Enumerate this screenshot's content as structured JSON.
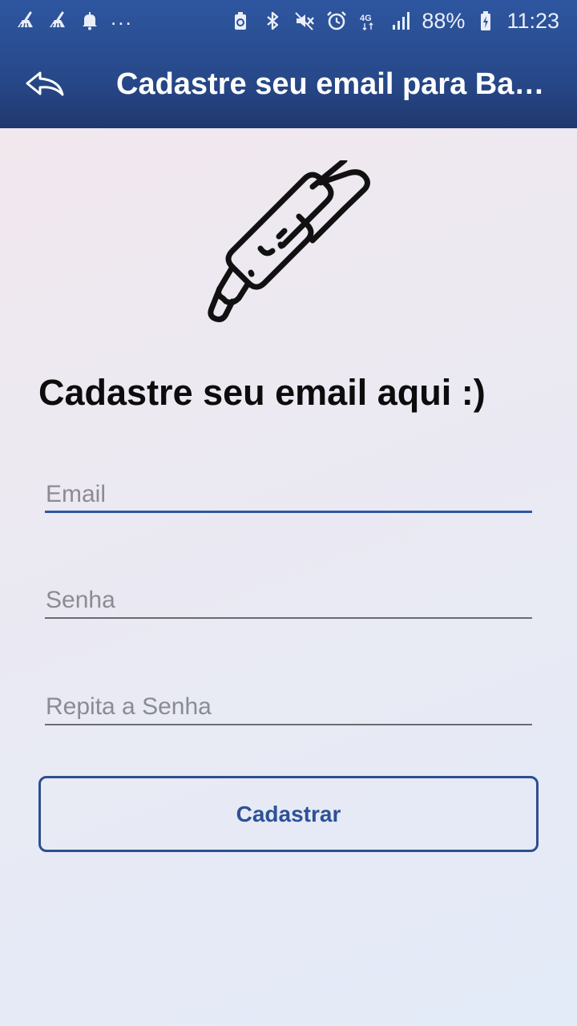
{
  "status_bar": {
    "battery": "88%",
    "time": "11:23",
    "network": "4G",
    "more_notifications": "...",
    "icons": [
      "cleaner-icon",
      "cleaner-icon",
      "notification-bell-icon",
      "battery-saver-icon",
      "bluetooth-icon",
      "mute-icon",
      "alarm-icon",
      "signal-icon",
      "battery-charging-icon"
    ]
  },
  "toolbar": {
    "title": "Cadastre seu email para Backup",
    "back_icon": "back-arrow-icon"
  },
  "illustration": {
    "icon": "pen-icon"
  },
  "form": {
    "heading": "Cadastre seu email aqui :)",
    "email_placeholder": "Email",
    "password_placeholder": "Senha",
    "repeat_password_placeholder": "Repita a Senha",
    "submit_label": "Cadastrar"
  },
  "colors": {
    "appbar": "#27498a",
    "accent": "#2d58a3",
    "button_text": "#2d5196"
  }
}
